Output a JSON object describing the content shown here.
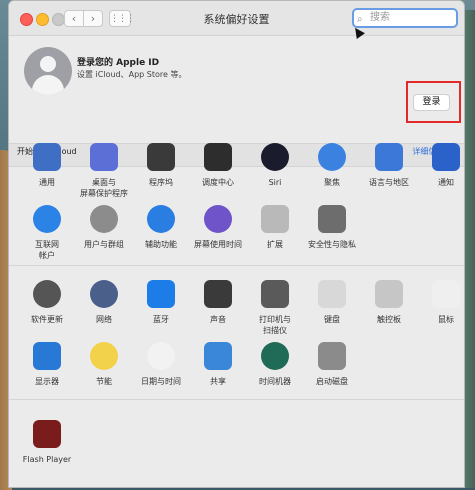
{
  "window": {
    "title": "系统偏好设置"
  },
  "search": {
    "placeholder": "搜索"
  },
  "account": {
    "title": "登录您的 Apple ID",
    "subtitle": "设置 iCloud、App Store 等。",
    "login_button": "登录",
    "icloud_label": "开始使用 iCloud",
    "details_link": "详细信息..."
  },
  "nav": {
    "back": "‹",
    "forward": "›",
    "grid": "⋮⋮⋮"
  },
  "row1": [
    {
      "label": "通用",
      "icon": "general-icon",
      "color": "#3f6fc4"
    },
    {
      "label": "桌面与\n屏幕保护程序",
      "icon": "desktop-icon",
      "color": "#5b6fd7"
    },
    {
      "label": "程序坞",
      "icon": "dock-icon",
      "color": "#3a3a3a"
    },
    {
      "label": "调度中心",
      "icon": "mission-control-icon",
      "color": "#2d2d2d"
    },
    {
      "label": "Siri",
      "icon": "siri-icon",
      "color": "#1b1b2e"
    },
    {
      "label": "聚焦",
      "icon": "spotlight-icon",
      "color": "#3b82e0"
    },
    {
      "label": "语言与地区",
      "icon": "language-icon",
      "color": "#3c78d8"
    },
    {
      "label": "通知",
      "icon": "notifications-icon",
      "color": "#2a62c9"
    }
  ],
  "row2": [
    {
      "label": "互联网\n帐户",
      "icon": "internet-accounts-icon",
      "color": "#2c83e6"
    },
    {
      "label": "用户与群组",
      "icon": "users-groups-icon",
      "color": "#8c8c8c"
    },
    {
      "label": "辅助功能",
      "icon": "accessibility-icon",
      "color": "#2a7de1"
    },
    {
      "label": "屏幕使用时间",
      "icon": "screen-time-icon",
      "color": "#6e53c9"
    },
    {
      "label": "扩展",
      "icon": "extensions-icon",
      "color": "#b9b9b9"
    },
    {
      "label": "安全性与隐私",
      "icon": "security-icon",
      "color": "#6d6d6d"
    }
  ],
  "row3": [
    {
      "label": "软件更新",
      "icon": "software-update-icon",
      "color": "#555555"
    },
    {
      "label": "网络",
      "icon": "network-icon",
      "color": "#4a5f8a"
    },
    {
      "label": "蓝牙",
      "icon": "bluetooth-icon",
      "color": "#1d7de8"
    },
    {
      "label": "声音",
      "icon": "sound-icon",
      "color": "#3a3a3a"
    },
    {
      "label": "打印机与\n扫描仪",
      "icon": "printers-icon",
      "color": "#5a5a5a"
    },
    {
      "label": "键盘",
      "icon": "keyboard-icon",
      "color": "#d8d8d8"
    },
    {
      "label": "触控板",
      "icon": "trackpad-icon",
      "color": "#c6c6c6"
    },
    {
      "label": "鼠标",
      "icon": "mouse-icon",
      "color": "#efefef"
    }
  ],
  "row4": [
    {
      "label": "显示器",
      "icon": "displays-icon",
      "color": "#2878d6"
    },
    {
      "label": "节能",
      "icon": "energy-saver-icon",
      "color": "#f3d24b"
    },
    {
      "label": "日期与时间",
      "icon": "date-time-icon",
      "color": "#f2f2f2"
    },
    {
      "label": "共享",
      "icon": "sharing-icon",
      "color": "#3a86d8"
    },
    {
      "label": "时间机器",
      "icon": "time-machine-icon",
      "color": "#1f6b57"
    },
    {
      "label": "启动磁盘",
      "icon": "startup-disk-icon",
      "color": "#8b8b8b"
    }
  ],
  "row5": [
    {
      "label": "Flash Player",
      "icon": "flash-player-icon",
      "color": "#7b1c1c"
    }
  ]
}
